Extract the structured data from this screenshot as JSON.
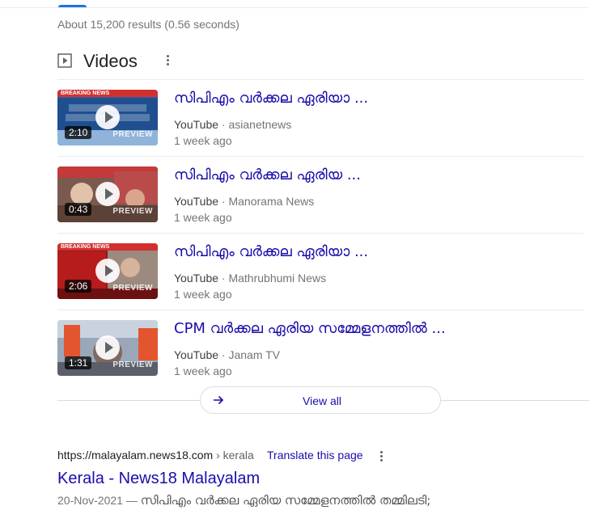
{
  "result_stats": "About 15,200 results (0.56 seconds)",
  "videos": {
    "heading": "Videos",
    "items": [
      {
        "title": "സിപിഎം വർക്കല ഏരിയാ ...",
        "platform": "YouTube",
        "separator": " · ",
        "channel": "asianetnews",
        "age": "1 week ago",
        "duration": "2:10",
        "preview": "PREVIEW",
        "banner": "BREAKING NEWS"
      },
      {
        "title": "സിപിഎം വർക്കല ഏരിയ ...",
        "platform": "YouTube",
        "separator": " · ",
        "channel": "Manorama News",
        "age": "1 week ago",
        "duration": "0:43",
        "preview": "PREVIEW",
        "banner": ""
      },
      {
        "title": "സിപിഎം വർക്കല ഏരിയാ ...",
        "platform": "YouTube",
        "separator": " · ",
        "channel": "Mathrubhumi News",
        "age": "1 week ago",
        "duration": "2:06",
        "preview": "PREVIEW",
        "banner": "BREAKING NEWS"
      },
      {
        "title": "CPM വർക്കല ഏരിയ സമ്മേളനത്തിൽ ...",
        "platform": "YouTube",
        "separator": " · ",
        "channel": "Janam TV",
        "age": "1 week ago",
        "duration": "1:31",
        "preview": "PREVIEW",
        "banner": ""
      }
    ],
    "view_all": "View all"
  },
  "result": {
    "cite_domain": "https://malayalam.news18.com",
    "cite_path": " › kerala",
    "translate": "Translate this page",
    "title": "Kerala - News18 Malayalam",
    "date": "20-Nov-2021",
    "dash": " — ",
    "snippet": "സിപിഎം വർക്കല ഏരിയ സമ്മേളനത്തിൽ തമ്മിലടി;"
  },
  "colors": {
    "link": "#1a0dab",
    "accent_tab": "#1a73e8",
    "breaking_red": "#d32f2f"
  }
}
